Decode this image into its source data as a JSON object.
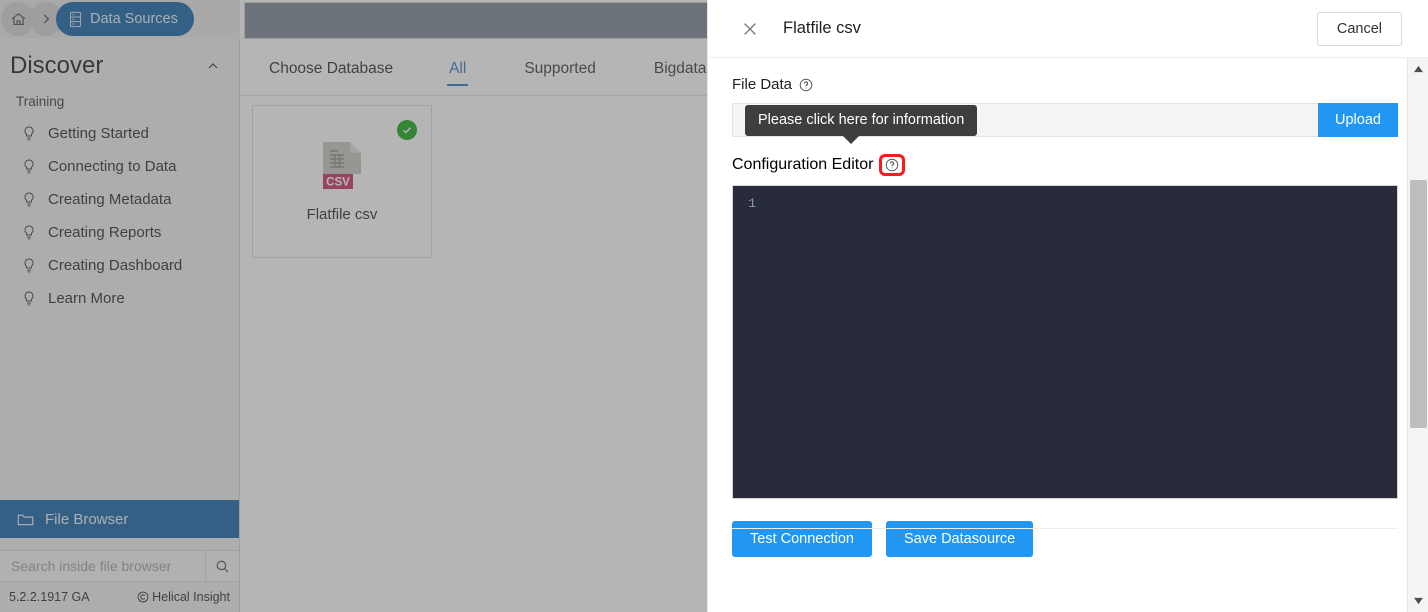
{
  "breadcrumb": {
    "home_icon": "home-icon",
    "separator_icon": "chevron-right-icon",
    "current_icon": "database-icon",
    "current_label": "Data Sources"
  },
  "sidebar": {
    "title": "Discover",
    "collapse_icon": "chevron-up-icon",
    "group_label": "Training",
    "items": [
      {
        "label": "Getting Started",
        "icon": "lightbulb-icon"
      },
      {
        "label": "Connecting to Data",
        "icon": "lightbulb-icon"
      },
      {
        "label": "Creating Metadata",
        "icon": "lightbulb-icon"
      },
      {
        "label": "Creating Reports",
        "icon": "lightbulb-icon"
      },
      {
        "label": "Creating Dashboard",
        "icon": "lightbulb-icon"
      },
      {
        "label": "Learn More",
        "icon": "lightbulb-icon"
      }
    ],
    "file_browser": {
      "label": "File Browser",
      "icon": "folder-icon"
    },
    "search": {
      "placeholder": "Search inside file browser",
      "value": "",
      "icon": "search-icon"
    },
    "footer": {
      "version": "5.2.2.1917 GA",
      "copyright_icon": "copyright-icon",
      "brand": "Helical Insight"
    }
  },
  "main": {
    "choose_database_label": "Choose Database",
    "tabs": [
      {
        "label": "All",
        "active": true
      },
      {
        "label": "Supported",
        "active": false
      },
      {
        "label": "Bigdata",
        "active": false
      }
    ],
    "cards": [
      {
        "label": "Flatfile csv",
        "icon": "csv-file-icon",
        "badge_icon": "check-circle-icon",
        "selected": true,
        "file_type": "CSV"
      }
    ]
  },
  "modal": {
    "close_icon": "close-icon",
    "title": "Flatfile csv",
    "cancel_label": "Cancel",
    "file_data": {
      "label": "File Data",
      "help_icon": "help-circle-icon",
      "input_value": "",
      "input_placeholder": "",
      "upload_label": "Upload"
    },
    "tooltip": {
      "text": "Please click here for information",
      "background": "#3e3e3e"
    },
    "configuration_editor": {
      "label": "Configuration Editor",
      "help_icon": "help-circle-icon",
      "highlight_color": "#f71b1b",
      "line_number": "1",
      "code": "",
      "background": "#282c3a"
    },
    "actions": [
      {
        "label": "Test Connection",
        "color": "#2196f3"
      },
      {
        "label": "Save Datasource",
        "color": "#2196f3"
      }
    ],
    "scrollbar": {
      "up_icon": "scroll-up-arrow-icon",
      "down_icon": "scroll-down-arrow-icon"
    }
  },
  "theme": {
    "accent_blue": "#2196f3",
    "nav_blue": "#1565a8",
    "success_green": "#17a81a",
    "highlight_red": "#f71b1b"
  }
}
